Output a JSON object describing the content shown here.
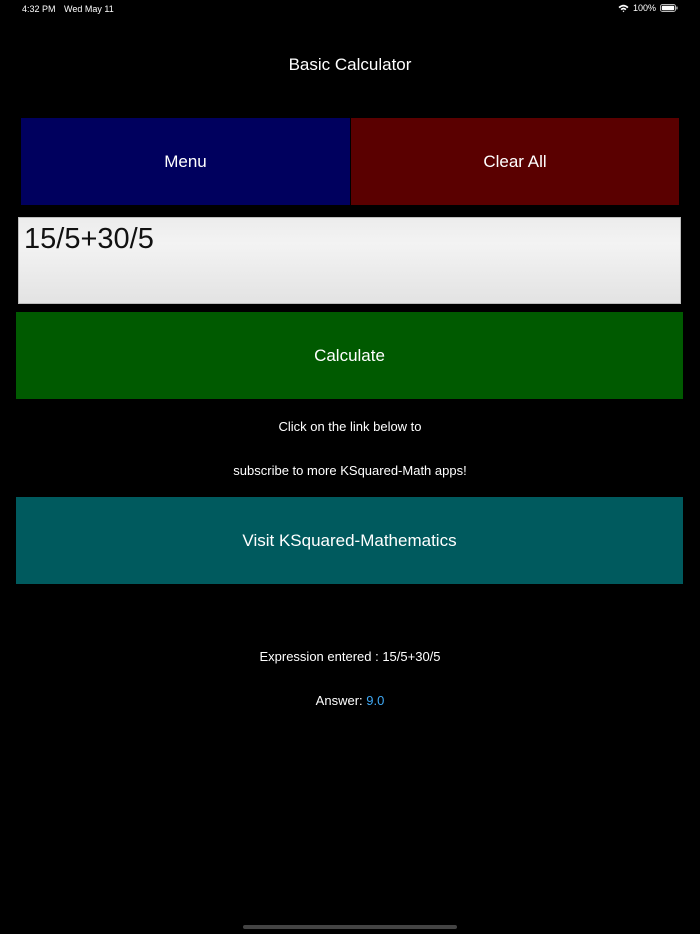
{
  "status_bar": {
    "time": "4:32 PM",
    "date": "Wed May 11",
    "battery_percent": "100%"
  },
  "header": {
    "title": "Basic Calculator"
  },
  "buttons": {
    "menu_label": "Menu",
    "clear_all_label": "Clear All",
    "calculate_label": "Calculate",
    "visit_label": "Visit KSquared-Mathematics"
  },
  "expression_input": {
    "value": "15/5+30/5",
    "placeholder": ""
  },
  "info": {
    "line1": "Click on the link below to",
    "line2": "subscribe to more KSquared-Math apps!"
  },
  "result": {
    "expression_label": "Expression entered : 15/5+30/5",
    "answer_label": "Answer: ",
    "answer_value": "9.0"
  },
  "colors": {
    "background": "#000000",
    "menu_button": "#00005e",
    "clear_button": "#5a0000",
    "calculate_button": "#005a00",
    "visit_button": "#005a5e",
    "answer_value": "#3fa9f5"
  },
  "icons": {
    "wifi": "wifi-icon",
    "battery": "battery-icon"
  }
}
